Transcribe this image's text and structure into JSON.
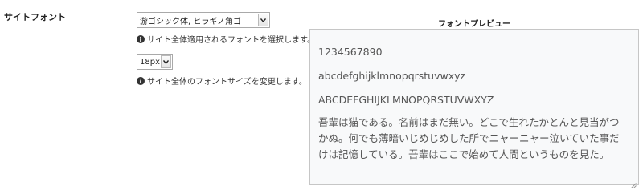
{
  "settings": {
    "label": "サイトフォント",
    "font": {
      "selected": "游ゴシック体, ヒラギノ角ゴ",
      "help": "サイト全体適用されるフォントを選択します。"
    },
    "size": {
      "selected": "18px",
      "help": "サイト全体のフォントサイズを変更します。"
    }
  },
  "preview": {
    "title": "フォントプレビュー",
    "digits": "1234567890",
    "lowercase": "abcdefghijklmnopqrstuvwxyz",
    "uppercase": "ABCDEFGHIJKLMNOPQRSTUVWXYZ",
    "japanese": "吾輩は猫である。名前はまだ無い。どこで生れたかとんと見当がつかぬ。何でも薄暗いじめじめした所でニャーニャー泣いていた事だけは記憶している。吾輩はここで始めて人間というものを見た。"
  },
  "icons": {
    "info": "info-circle-icon",
    "dropdown": "chevron-down-icon",
    "resize": "resize-grip-icon"
  }
}
